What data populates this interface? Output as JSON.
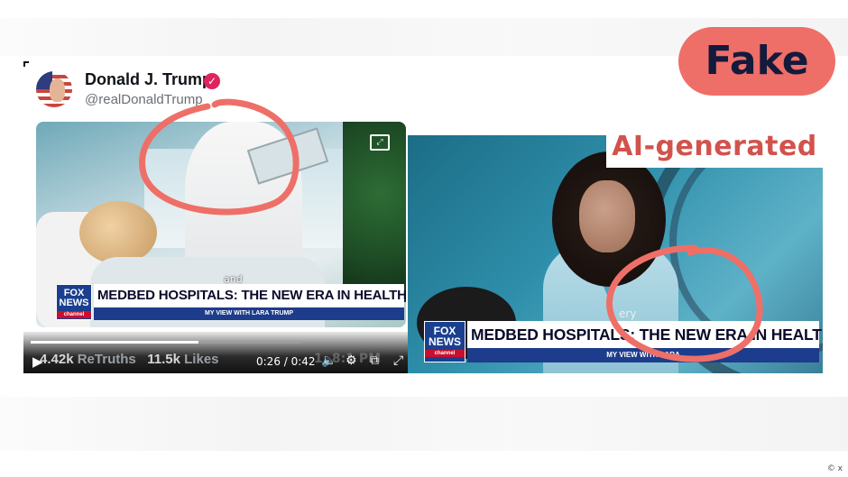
{
  "labels": {
    "fake": "Fake",
    "ai_generated": "AI-generated",
    "copyright": "© x"
  },
  "tweet": {
    "display_name": "Donald J. Trump",
    "handle": "@realDonaldTrump",
    "verified": true,
    "video": {
      "subtitle_fragment": "and",
      "chyron_headline": "MEDBED HOSPITALS: THE NEW ERA IN HEALTHCARE",
      "chyron_subtitle": "MY VIEW WITH LARA TRUMP",
      "network_logo": "FOX NEWS",
      "network_sub": "channel"
    },
    "player": {
      "retruths_count": "4.42k",
      "retruths_label": "ReTruths",
      "likes_count": "11.5k",
      "likes_label": "Likes",
      "time": "0:26 / 0:42",
      "progress_fraction": 0.62,
      "ghost_timestamp": "1, 8:1 PM"
    }
  },
  "right_video": {
    "subtitle_fragment": "ery",
    "chyron_headline": "MEDBED HOSPITALS: THE NEW ERA IN HEALTHCARE",
    "chyron_subtitle": "MY VIEW WITH LARA",
    "network_logo": "FOX NEWS",
    "network_sub": "channel"
  },
  "colors": {
    "highlight": "#ee6f68",
    "fake_text": "#141a3c",
    "ai_text": "#d2524c",
    "fox_blue": "#1d3c8b"
  },
  "icons": [
    "verified-badge-icon",
    "expand-icon",
    "play-icon",
    "volume-icon",
    "settings-icon",
    "fullscreen-icon"
  ]
}
